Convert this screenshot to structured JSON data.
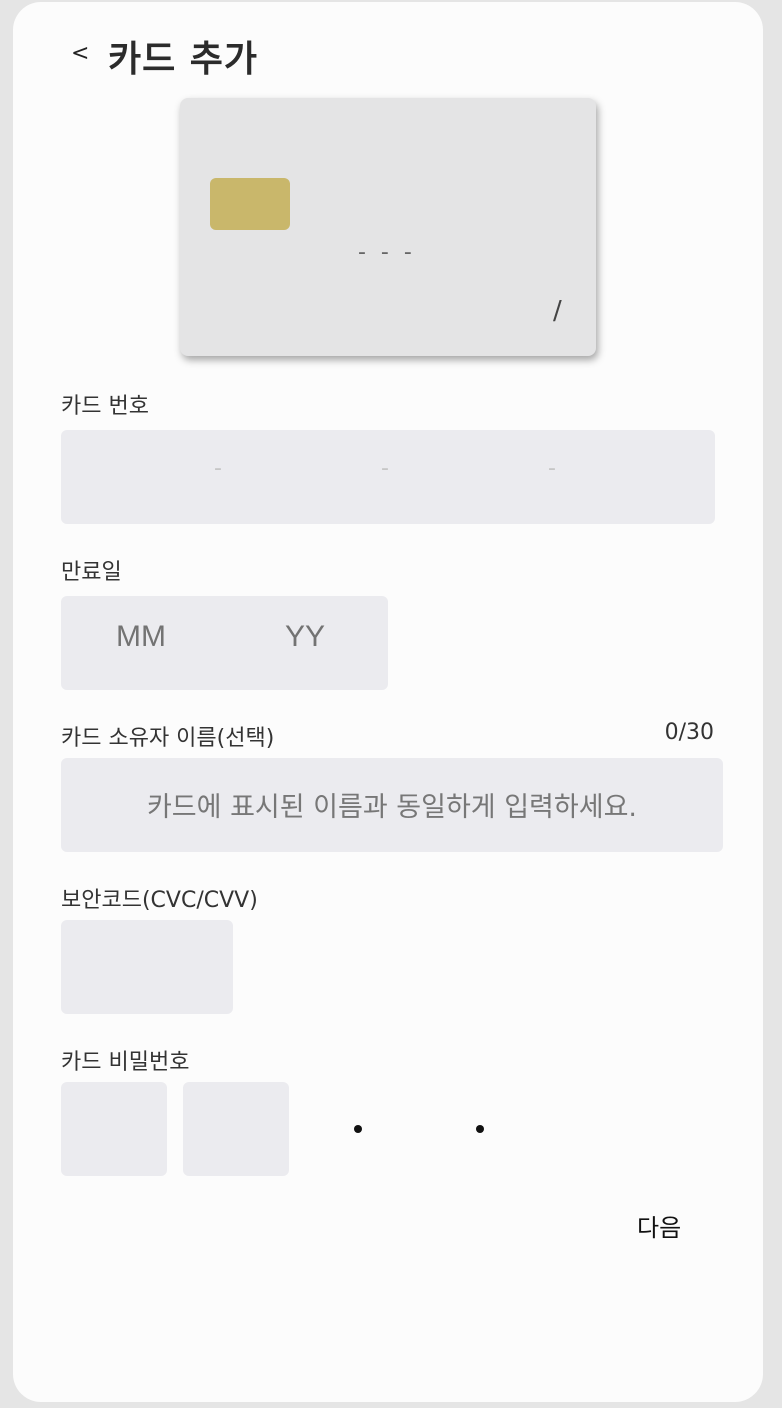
{
  "header": {
    "back_label": "<",
    "title": "카드 추가"
  },
  "card_preview": {
    "number_placeholder": "- - -",
    "expiry_placeholder": "/",
    "chip_color": "#c9b76b",
    "card_color": "#e4e4e5"
  },
  "form": {
    "card_number": {
      "label": "카드 번호",
      "separators": [
        "-",
        "-",
        "-"
      ]
    },
    "expiry": {
      "label": "만료일",
      "month_placeholder": "MM",
      "year_placeholder": "YY"
    },
    "owner_name": {
      "label": "카드 소유자 이름(선택)",
      "counter": "0/30",
      "placeholder": "카드에 표시된 이름과 동일하게 입력하세요."
    },
    "cvc": {
      "label": "보안코드(CVC/CVV)"
    },
    "password": {
      "label": "카드 비밀번호",
      "masked_digits": [
        "•",
        "•"
      ]
    }
  },
  "actions": {
    "next_label": "다음"
  },
  "colors": {
    "input_bg": "#ebebef",
    "app_bg": "#fcfcfc"
  }
}
